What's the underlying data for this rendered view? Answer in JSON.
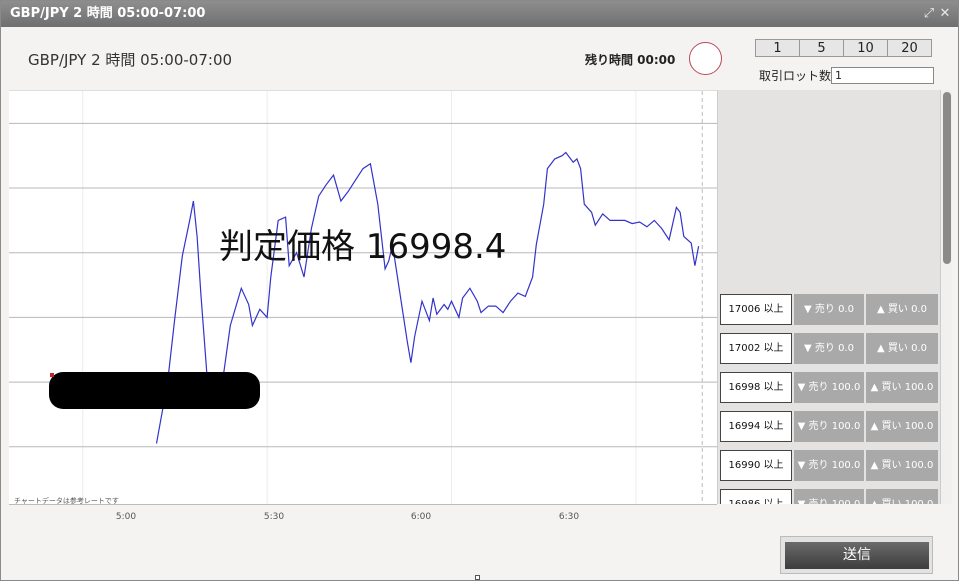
{
  "window": {
    "title": "GBP/JPY 2 時間 05:00-07:00",
    "fullscreen_icon": "⤢",
    "close_icon": "✕"
  },
  "header": {
    "symbol_title": "GBP/JPY 2 時間 05:00-07:00",
    "remaining_label": "残り時間 00:00",
    "lot_buttons": [
      "1",
      "5",
      "10",
      "20"
    ],
    "lot_label": "取引ロット数",
    "lot_value": "1"
  },
  "chart": {
    "judge_price_label": "判定価格 16998.4",
    "note": "チャートデータは参考レートです",
    "x_ticks": [
      "5:00",
      "5:30",
      "6:00",
      "6:30"
    ]
  },
  "chart_data": {
    "type": "line",
    "series": [
      {
        "color": "#3333cc",
        "points": [
          [
            5.2,
            16986.2
          ],
          [
            5.23,
            16990.0
          ],
          [
            5.25,
            16994.0
          ],
          [
            5.27,
            16997.8
          ],
          [
            5.29,
            17000.0
          ],
          [
            5.3,
            17001.2
          ],
          [
            5.31,
            16999.0
          ],
          [
            5.32,
            16995.5
          ],
          [
            5.34,
            16989.5
          ],
          [
            5.36,
            16990.5
          ],
          [
            5.38,
            16990.2
          ],
          [
            5.4,
            16993.5
          ],
          [
            5.43,
            16995.8
          ],
          [
            5.45,
            16994.8
          ],
          [
            5.46,
            16993.5
          ],
          [
            5.48,
            16994.5
          ],
          [
            5.5,
            16994.0
          ],
          [
            5.51,
            16996.5
          ],
          [
            5.53,
            17000.0
          ],
          [
            5.55,
            17000.2
          ],
          [
            5.56,
            16997.2
          ],
          [
            5.58,
            16998.0
          ],
          [
            5.6,
            16996.5
          ],
          [
            5.62,
            16999.5
          ],
          [
            5.64,
            17001.5
          ],
          [
            5.66,
            17002.2
          ],
          [
            5.68,
            17002.8
          ],
          [
            5.7,
            17001.2
          ],
          [
            5.72,
            17001.8
          ],
          [
            5.74,
            17002.5
          ],
          [
            5.76,
            17003.2
          ],
          [
            5.78,
            17003.5
          ],
          [
            5.8,
            17001.0
          ],
          [
            5.82,
            16997.0
          ],
          [
            5.83,
            16997.5
          ],
          [
            5.84,
            16998.5
          ],
          [
            5.86,
            16995.5
          ],
          [
            5.88,
            16992.5
          ],
          [
            5.89,
            16991.2
          ],
          [
            5.9,
            16992.8
          ],
          [
            5.92,
            16995.0
          ],
          [
            5.94,
            16993.8
          ],
          [
            5.95,
            16995.2
          ],
          [
            5.96,
            16994.2
          ],
          [
            5.98,
            16994.8
          ],
          [
            5.99,
            16994.5
          ],
          [
            6.0,
            16995.0
          ],
          [
            6.02,
            16994.0
          ],
          [
            6.03,
            16995.2
          ],
          [
            6.05,
            16995.8
          ],
          [
            6.07,
            16995.0
          ],
          [
            6.08,
            16994.3
          ],
          [
            6.1,
            16994.7
          ],
          [
            6.12,
            16994.7
          ],
          [
            6.14,
            16994.3
          ],
          [
            6.16,
            16995.0
          ],
          [
            6.18,
            16995.5
          ],
          [
            6.2,
            16995.3
          ],
          [
            6.22,
            16996.5
          ],
          [
            6.23,
            16998.5
          ],
          [
            6.25,
            17001.0
          ],
          [
            6.26,
            17003.2
          ],
          [
            6.28,
            17003.8
          ],
          [
            6.3,
            17004.0
          ],
          [
            6.31,
            17004.2
          ],
          [
            6.33,
            17003.6
          ],
          [
            6.34,
            17003.8
          ],
          [
            6.35,
            17003.2
          ],
          [
            6.36,
            17001.0
          ],
          [
            6.38,
            17000.5
          ],
          [
            6.39,
            16999.7
          ],
          [
            6.41,
            17000.4
          ],
          [
            6.43,
            17000.0
          ],
          [
            6.45,
            17000.0
          ],
          [
            6.47,
            17000.0
          ],
          [
            6.49,
            16999.8
          ],
          [
            6.51,
            16999.9
          ],
          [
            6.53,
            16999.6
          ],
          [
            6.55,
            17000.0
          ],
          [
            6.57,
            16999.5
          ],
          [
            6.59,
            16998.8
          ],
          [
            6.61,
            17000.8
          ],
          [
            6.62,
            17000.5
          ],
          [
            6.63,
            16999.0
          ],
          [
            6.65,
            16998.6
          ],
          [
            6.66,
            16997.2
          ],
          [
            6.67,
            16998.4
          ]
        ]
      }
    ],
    "xlim": [
      4.8,
      6.72
    ],
    "ylim": [
      16982.4,
      17008.0
    ],
    "reference_lines": [
      17006,
      17002,
      16998,
      16994,
      16990,
      16986
    ],
    "grid": true
  },
  "panel": {
    "rows": [
      {
        "price": "17006 以上",
        "sell": "▼ 売り 0.0",
        "buy": "▲ 買い 0.0"
      },
      {
        "price": "17002 以上",
        "sell": "▼ 売り 0.0",
        "buy": "▲ 買い 0.0"
      },
      {
        "price": "16998 以上",
        "sell": "▼ 売り 100.0",
        "buy": "▲ 買い 100.0"
      },
      {
        "price": "16994 以上",
        "sell": "▼ 売り 100.0",
        "buy": "▲ 買い 100.0"
      },
      {
        "price": "16990 以上",
        "sell": "▼ 売り 100.0",
        "buy": "▲ 買い 100.0"
      },
      {
        "price": "16986 以上",
        "sell": "▼ 売り 100.0",
        "buy": "▲ 買い 100.0"
      }
    ]
  },
  "footer": {
    "send_label": "送信"
  }
}
